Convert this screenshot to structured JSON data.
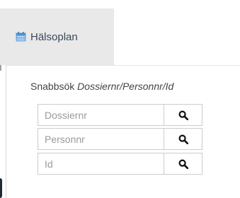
{
  "tab": {
    "label": "Hälsoplan",
    "icon": "calendar-icon"
  },
  "search": {
    "heading_prefix": "Snabbsök ",
    "heading_fields": "Dossiernr/Personnr/Id",
    "fields": [
      {
        "placeholder": "Dossiernr",
        "button_icon": "search-icon"
      },
      {
        "placeholder": "Personnr",
        "button_icon": "search-icon"
      },
      {
        "placeholder": "Id",
        "button_icon": "search-icon"
      }
    ]
  },
  "colors": {
    "tab_background": "#e9e9e9",
    "calendar_icon": "#6aa7e0",
    "text": "#444444"
  }
}
